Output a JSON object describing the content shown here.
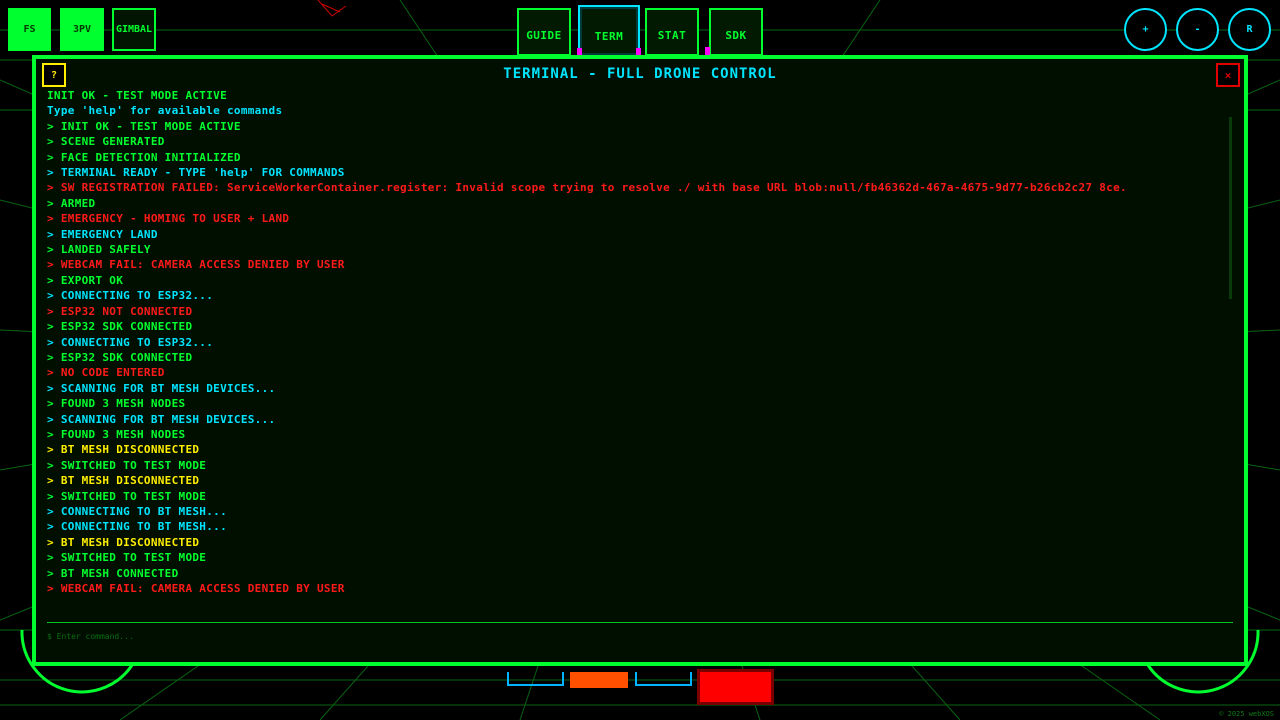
{
  "modes": [
    {
      "label": "FS",
      "active": true
    },
    {
      "label": "3PV",
      "active": true
    },
    {
      "label": "GIMBAL",
      "active": false
    }
  ],
  "tabs": [
    {
      "label": "GUIDE",
      "active": false
    },
    {
      "label": "TERM",
      "active": true
    },
    {
      "label": "STAT",
      "active": false
    },
    {
      "label": "SDK",
      "active": false
    }
  ],
  "round_buttons": {
    "zoom_in": "+",
    "zoom_out": "-",
    "reset": "R"
  },
  "terminal": {
    "title": "TERMINAL - FULL DRONE CONTROL",
    "help_label": "?",
    "close_label": "×",
    "input_placeholder": "$ Enter command...",
    "lines": [
      {
        "text": "INIT OK - TEST MODE ACTIVE",
        "color": "green"
      },
      {
        "text": "Type 'help' for available commands",
        "color": "cyan"
      },
      {
        "text": "> INIT OK - TEST MODE ACTIVE",
        "color": "green"
      },
      {
        "text": "> SCENE GENERATED",
        "color": "green"
      },
      {
        "text": "> FACE DETECTION INITIALIZED",
        "color": "green"
      },
      {
        "text": "> TERMINAL READY - TYPE 'help' FOR COMMANDS",
        "color": "cyan"
      },
      {
        "text": "> SW REGISTRATION FAILED: ServiceWorkerContainer.register: Invalid scope trying to resolve ./ with base URL blob:null/fb46362d-467a-4675-9d77-b26cb2c27 8ce.",
        "color": "red"
      },
      {
        "text": "> ARMED",
        "color": "green"
      },
      {
        "text": "> EMERGENCY - HOMING TO USER + LAND",
        "color": "red"
      },
      {
        "text": "> EMERGENCY LAND",
        "color": "cyan"
      },
      {
        "text": "> LANDED SAFELY",
        "color": "green"
      },
      {
        "text": "> WEBCAM FAIL: CAMERA ACCESS DENIED BY USER",
        "color": "red"
      },
      {
        "text": "> EXPORT OK",
        "color": "green"
      },
      {
        "text": "> CONNECTING TO ESP32...",
        "color": "cyan"
      },
      {
        "text": "> ESP32 NOT CONNECTED",
        "color": "red"
      },
      {
        "text": "> ESP32 SDK CONNECTED",
        "color": "green"
      },
      {
        "text": "> CONNECTING TO ESP32...",
        "color": "cyan"
      },
      {
        "text": "> ESP32 SDK CONNECTED",
        "color": "green"
      },
      {
        "text": "> NO CODE ENTERED",
        "color": "red"
      },
      {
        "text": "> SCANNING FOR BT MESH DEVICES...",
        "color": "cyan"
      },
      {
        "text": "> FOUND 3 MESH NODES",
        "color": "green"
      },
      {
        "text": "> SCANNING FOR BT MESH DEVICES...",
        "color": "cyan"
      },
      {
        "text": "> FOUND 3 MESH NODES",
        "color": "green"
      },
      {
        "text": "> BT MESH DISCONNECTED",
        "color": "yellow"
      },
      {
        "text": "> SWITCHED TO TEST MODE",
        "color": "green"
      },
      {
        "text": "> BT MESH DISCONNECTED",
        "color": "yellow"
      },
      {
        "text": "> SWITCHED TO TEST MODE",
        "color": "green"
      },
      {
        "text": "> CONNECTING TO BT MESH...",
        "color": "cyan"
      },
      {
        "text": "> CONNECTING TO BT MESH...",
        "color": "cyan"
      },
      {
        "text": "> BT MESH DISCONNECTED",
        "color": "yellow"
      },
      {
        "text": "> SWITCHED TO TEST MODE",
        "color": "green"
      },
      {
        "text": "> BT MESH CONNECTED",
        "color": "green"
      },
      {
        "text": "> WEBCAM FAIL: CAMERA ACCESS DENIED BY USER",
        "color": "red"
      }
    ]
  },
  "footer": {
    "copyright": "© 2025 webXOS"
  },
  "colors": {
    "neon_green": "#00ff2e",
    "cyan": "#00e5ff",
    "red": "#ff1a1a",
    "yellow": "#ffee00",
    "orange": "#ff5000",
    "background": "#000000"
  }
}
